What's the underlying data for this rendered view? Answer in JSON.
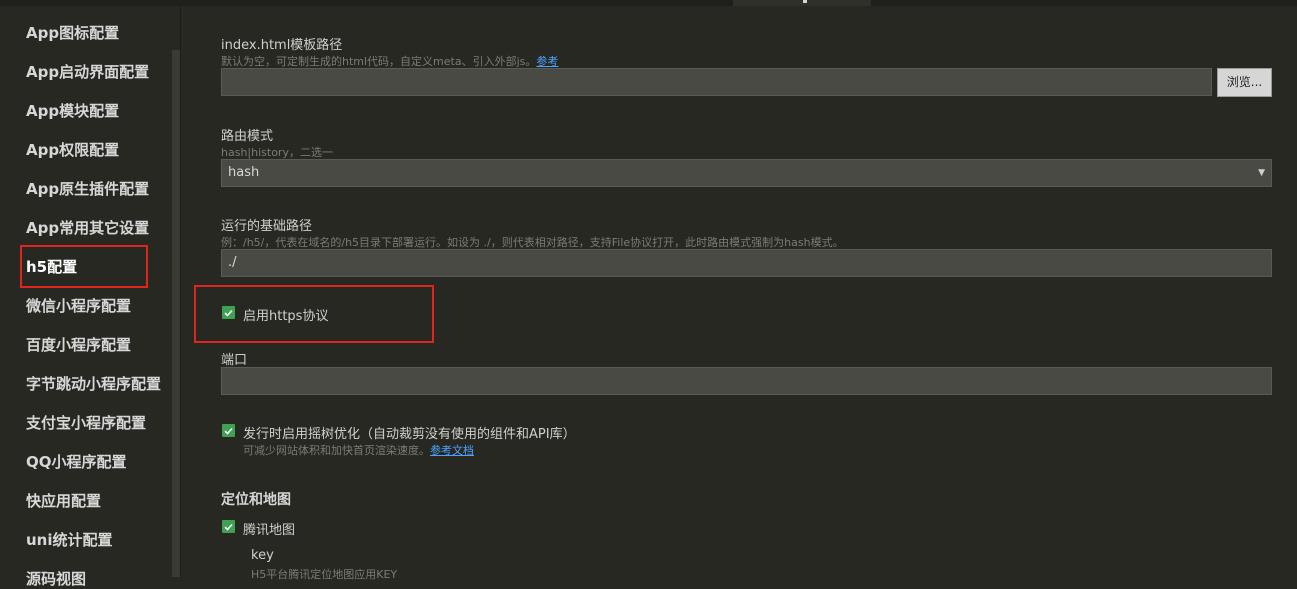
{
  "sidebar": {
    "items": [
      {
        "label": "App图标配置"
      },
      {
        "label": "App启动界面配置"
      },
      {
        "label": "App模块配置"
      },
      {
        "label": "App权限配置"
      },
      {
        "label": "App原生插件配置"
      },
      {
        "label": "App常用其它设置"
      },
      {
        "label": "h5配置"
      },
      {
        "label": "微信小程序配置"
      },
      {
        "label": "百度小程序配置"
      },
      {
        "label": "字节跳动小程序配置"
      },
      {
        "label": "支付宝小程序配置"
      },
      {
        "label": "QQ小程序配置"
      },
      {
        "label": "快应用配置"
      },
      {
        "label": "uni统计配置"
      },
      {
        "label": "源码视图"
      }
    ],
    "active_item": "h5配置"
  },
  "form": {
    "template": {
      "label": "index.html模板路径",
      "hint": "默认为空，可定制生成的html代码，自定义meta、引入外部js。",
      "hint_link": "参考",
      "value": "",
      "browse_label": "浏览..."
    },
    "router": {
      "label": "路由模式",
      "hint": "hash|history，二选一",
      "value": "hash"
    },
    "base": {
      "label": "运行的基础路径",
      "hint": "例：/h5/，代表在域名的/h5目录下部署运行。如设为 ./，则代表相对路径，支持File协议打开，此时路由模式强制为hash模式。",
      "value": "./"
    },
    "https": {
      "label": "启用https协议",
      "checked": true
    },
    "port": {
      "label": "端口",
      "value": ""
    },
    "treeshaking": {
      "label": "发行时启用摇树优化（自动裁剪没有使用的组件和API库）",
      "hint": "可减少网站体积和加快首页渲染速度。",
      "hint_link": "参考文档",
      "checked": true
    },
    "map": {
      "section_title": "定位和地图",
      "tencent_label": "腾讯地图",
      "tencent_checked": true,
      "key_label": "key",
      "key_hint": "H5平台腾讯定位地图应用KEY"
    }
  },
  "colors": {
    "highlight": "#e0251e",
    "checkbox": "#3fa153",
    "link": "#4da3ff"
  }
}
